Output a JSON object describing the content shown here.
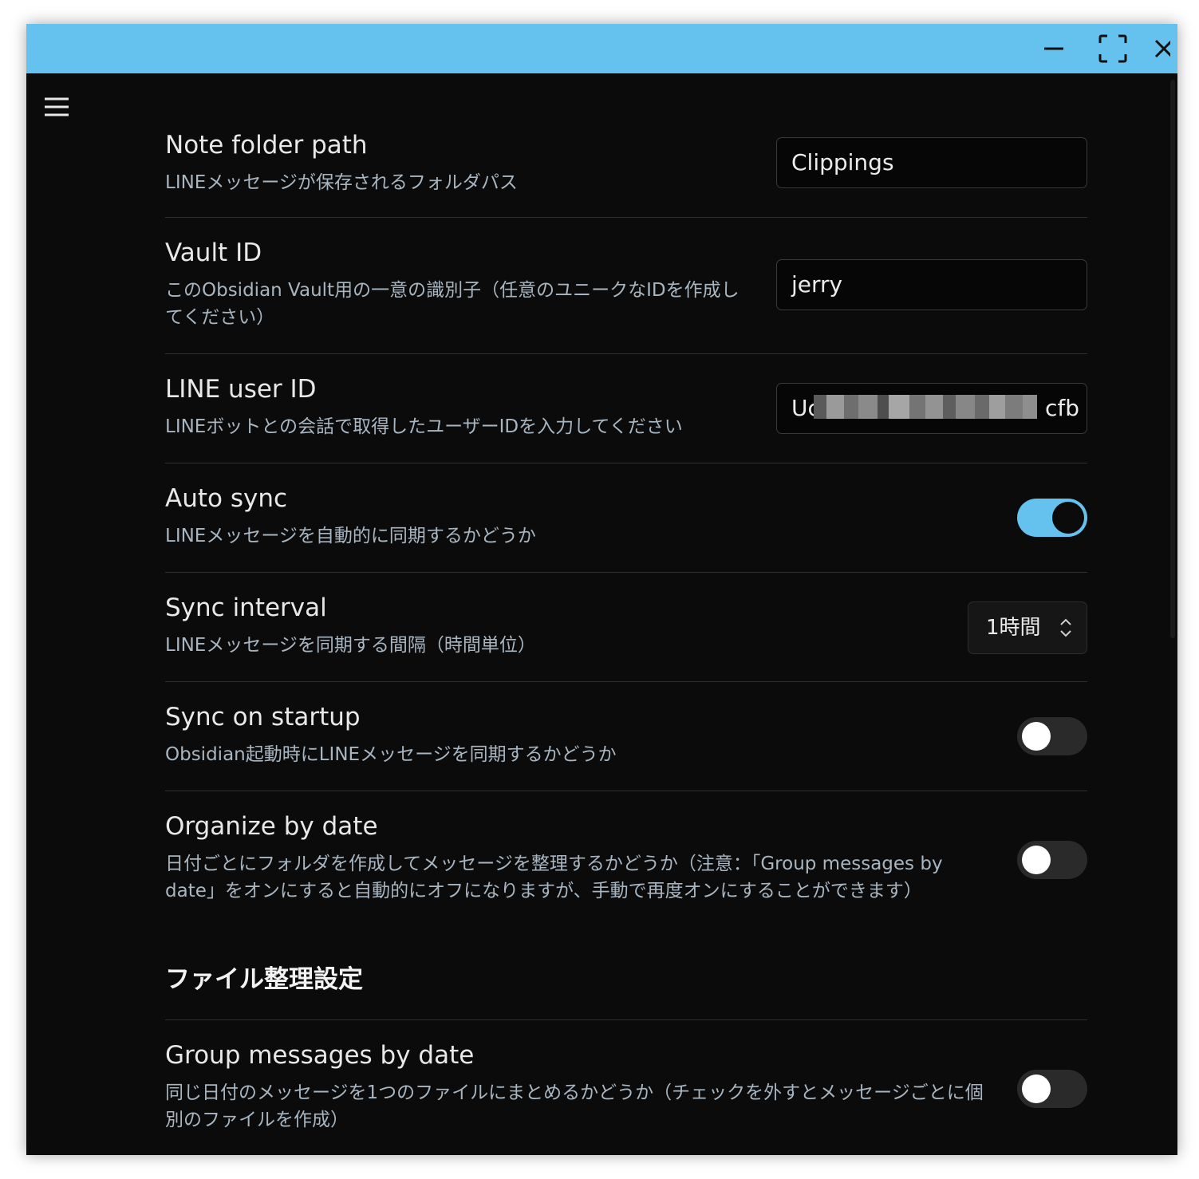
{
  "window": {
    "titlebar_color": "#65c2ee",
    "controls": [
      "minimize-icon",
      "maximize-icon",
      "close-icon"
    ]
  },
  "menu": {
    "icon": "hamburger-menu-icon"
  },
  "settings": [
    {
      "name": "Note folder path",
      "desc": "LINEメッセージが保存されるフォルダパス",
      "control": "text",
      "value": "Clippings"
    },
    {
      "name": "Vault ID",
      "desc": "このObsidian Vault用の一意の識別子（任意のユニークなIDを作成してください）",
      "control": "text",
      "value": "jerry"
    },
    {
      "name": "LINE user ID",
      "desc": "LINEボットとの会話で取得したユーザーIDを入力してください",
      "control": "text",
      "value_prefix": "Uc",
      "value_suffix": "cfb"
    },
    {
      "name": "Auto sync",
      "desc": "LINEメッセージを自動的に同期するかどうか",
      "control": "toggle",
      "enabled": true
    },
    {
      "name": "Sync interval",
      "desc": "LINEメッセージを同期する間隔（時間単位）",
      "control": "select",
      "value": "1時間"
    },
    {
      "name": "Sync on startup",
      "desc": "Obsidian起動時にLINEメッセージを同期するかどうか",
      "control": "toggle",
      "enabled": false
    },
    {
      "name": "Organize by date",
      "desc": "日付ごとにフォルダを作成してメッセージを整理するかどうか（注意：「Group messages by date」をオンにすると自動的にオフになりますが、手動で再度オンにすることができます）",
      "control": "toggle",
      "enabled": false
    }
  ],
  "section": {
    "heading": "ファイル整理設定"
  },
  "section_settings": [
    {
      "name": "Group messages by date",
      "desc": "同じ日付のメッセージを1つのファイルにまとめるかどうか（チェックを外すとメッセージごとに個別のファイルを作成）",
      "control": "toggle",
      "enabled": false
    }
  ],
  "colors": {
    "accent": "#65c2ee",
    "background": "#0b0b0b",
    "description_text": "#a8b6c2"
  }
}
